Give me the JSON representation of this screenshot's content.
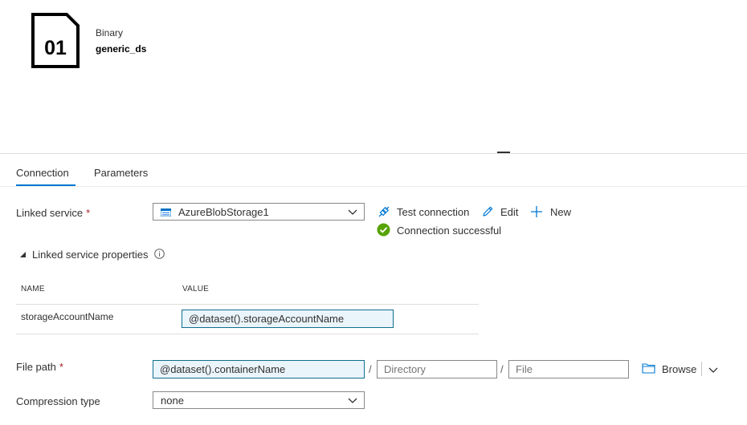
{
  "dataset": {
    "icon_text": "01",
    "type": "Binary",
    "name": "generic_ds"
  },
  "tabs": [
    {
      "label": "Connection",
      "active": true
    },
    {
      "label": "Parameters",
      "active": false
    }
  ],
  "linked_service": {
    "label": "Linked service",
    "required_marker": "*",
    "selected": "AzureBlobStorage1",
    "test_connection_label": "Test connection",
    "edit_label": "Edit",
    "new_label": "New",
    "status_text": "Connection successful"
  },
  "linked_service_properties": {
    "title": "Linked service properties",
    "expanded": true,
    "columns": [
      "NAME",
      "VALUE"
    ],
    "rows": [
      {
        "name": "storageAccountName",
        "value": "@dataset().storageAccountName"
      }
    ]
  },
  "file_path": {
    "label": "File path",
    "required_marker": "*",
    "container_value": "@dataset().containerName",
    "separator": "/",
    "directory_placeholder": "Directory",
    "file_placeholder": "File",
    "browse_label": "Browse"
  },
  "compression": {
    "label": "Compression type",
    "selected": "none"
  },
  "colors": {
    "accent": "#0078d4",
    "success": "#57a300",
    "expression_bg": "#eaf4fb",
    "expression_border": "#0f6f8f",
    "required": "#a4262c"
  }
}
